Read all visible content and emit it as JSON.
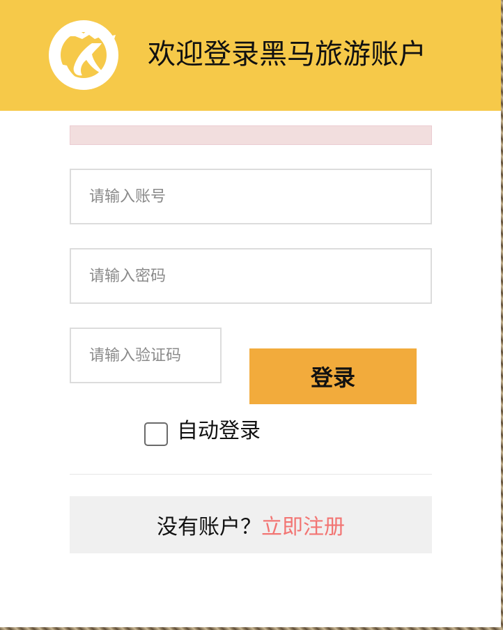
{
  "header": {
    "title": "欢迎登录黑马旅游账户",
    "background": "#f6c949",
    "logo": "horse-logo-icon"
  },
  "error": {
    "text": ""
  },
  "form": {
    "username_placeholder": "请输入账号",
    "password_placeholder": "请输入密码",
    "captcha_placeholder": "请输入验证码",
    "login_label": "登录",
    "login_color": "#f2ab3c",
    "remember_label": "自动登录",
    "remember_checked": false
  },
  "register": {
    "prompt": "没有账户？",
    "link_label": "立即注册",
    "link_color": "#f27573"
  }
}
